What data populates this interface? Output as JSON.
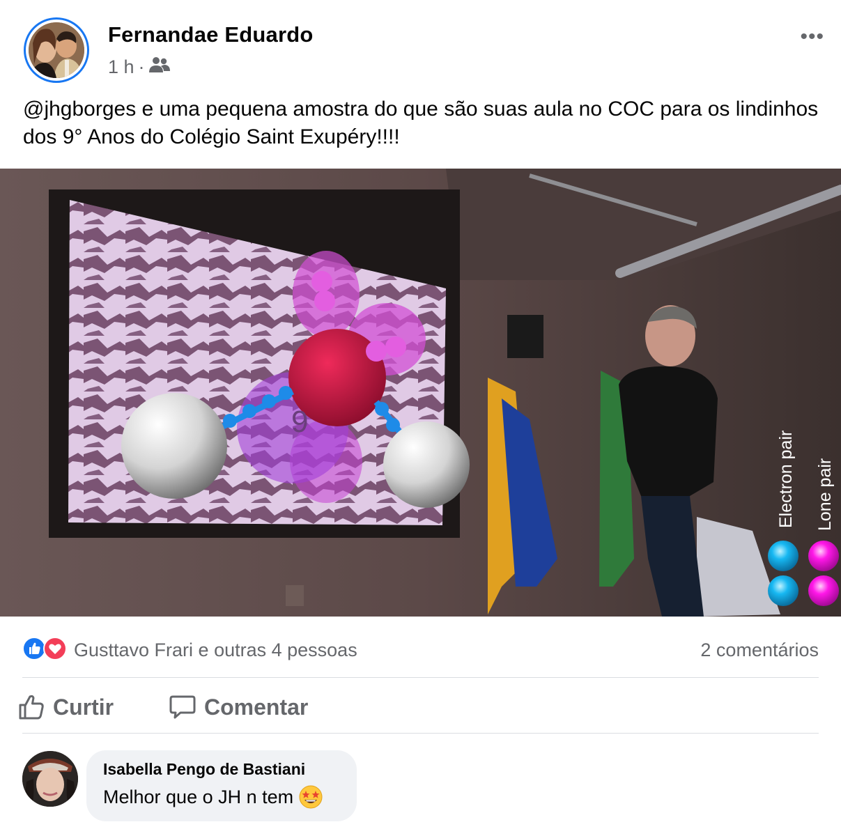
{
  "post": {
    "author": "Fernandae Eduardo",
    "time": "1 h",
    "separator": "·",
    "audience_icon": "friends-icon",
    "more_icon": "more-icon",
    "more_label": "•••",
    "text": "@jhgborges e uma pequena amostra do que são suas aula no COC para os lindinhos dos 9° Anos do Colégio Saint Exupéry!!!!"
  },
  "photo": {
    "projection_number": "9",
    "legend_electron": "Electron pair",
    "legend_lone": "Lone pair",
    "colors": {
      "electron": "#17b8f2",
      "lone": "#ff17e8",
      "oxygen": "#c8103e",
      "hydrogen": "#e8e8e8"
    }
  },
  "reactions": {
    "icons": [
      "like-icon",
      "love-icon"
    ],
    "summary": "Gusttavo Frari e outras 4 pessoas",
    "comments_count": "2 comentários"
  },
  "actions": {
    "like_label": "Curtir",
    "comment_label": "Comentar"
  },
  "comments": [
    {
      "name": "Isabella Pengo de Bastiani",
      "text": "Melhor que o JH n tem",
      "emoji": "star-struck-emoji"
    }
  ],
  "colors": {
    "accent": "#1877f2",
    "muted": "#65676b",
    "bubble": "#f0f2f5",
    "love": "#f33e58"
  }
}
